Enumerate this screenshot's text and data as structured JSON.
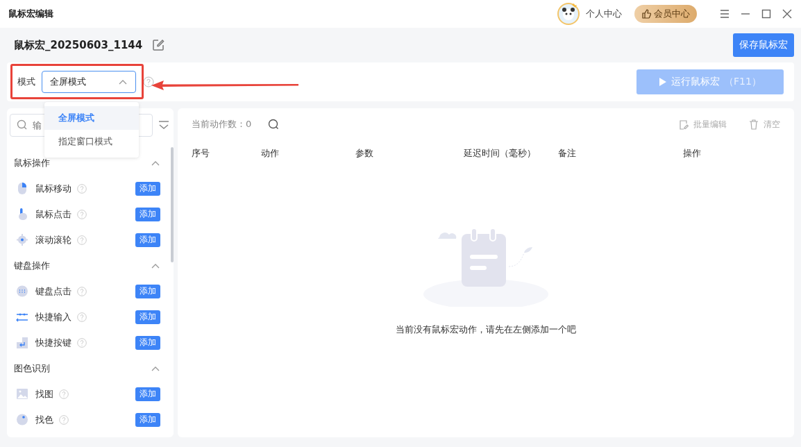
{
  "window": {
    "title": "鼠标宏编辑",
    "user_link": "个人中心",
    "member_button": "会员中心"
  },
  "macro": {
    "name": "鼠标宏_20250603_1144",
    "save_button": "保存鼠标宏"
  },
  "mode": {
    "label": "模式",
    "value": "全屏模式",
    "expanded": true,
    "options": [
      {
        "label": "全屏模式",
        "selected": true
      },
      {
        "label": "指定窗口模式",
        "selected": false
      }
    ]
  },
  "run_button": {
    "label": "运行鼠标宏",
    "shortcut": "（F11）",
    "disabled": true
  },
  "sidebar": {
    "search": {
      "placeholder": "输"
    },
    "groups": [
      {
        "title": "鼠标操作",
        "expanded": true,
        "items": [
          {
            "label": "鼠标移动",
            "kind": "mouse",
            "button": "添加"
          },
          {
            "label": "鼠标点击",
            "kind": "hand",
            "button": "添加"
          },
          {
            "label": "滚动滚轮",
            "kind": "wheel",
            "button": "添加"
          }
        ]
      },
      {
        "title": "键盘操作",
        "expanded": true,
        "items": [
          {
            "label": "键盘点击",
            "kind": "keyboard",
            "button": "添加"
          },
          {
            "label": "快捷输入",
            "kind": "arrows",
            "button": "添加"
          },
          {
            "label": "快捷按键",
            "kind": "enter",
            "button": "添加"
          }
        ]
      },
      {
        "title": "图色识别",
        "expanded": true,
        "items": [
          {
            "label": "找图",
            "kind": "image",
            "button": "添加"
          },
          {
            "label": "找色",
            "kind": "color",
            "button": "添加"
          }
        ]
      }
    ]
  },
  "actions": {
    "count_label": "当前动作数：",
    "count": "0",
    "batch_edit": {
      "label": "批量编辑",
      "disabled": true
    },
    "clear": {
      "label": "清空",
      "disabled": true
    },
    "columns": [
      "序号",
      "动作",
      "参数",
      "延迟时间（毫秒）",
      "备注",
      "操作"
    ],
    "empty_message": "当前没有鼠标宏动作，请先在左侧添加一个吧"
  }
}
